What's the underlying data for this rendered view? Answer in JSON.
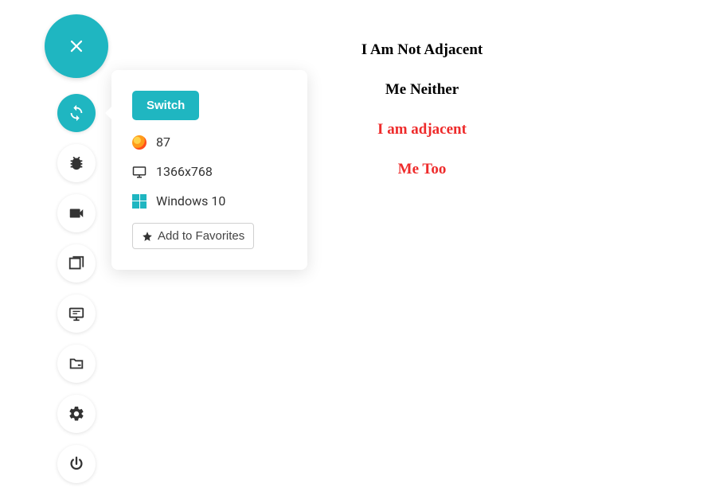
{
  "popover": {
    "switch_label": "Switch",
    "browser_version": "87",
    "resolution": "1366x768",
    "os": "Windows 10",
    "favorites_label": "Add to Favorites"
  },
  "content": {
    "line1": "I Am Not Adjacent",
    "line2": "Me Neither",
    "line3": "I am adjacent",
    "line4": "Me Too"
  }
}
